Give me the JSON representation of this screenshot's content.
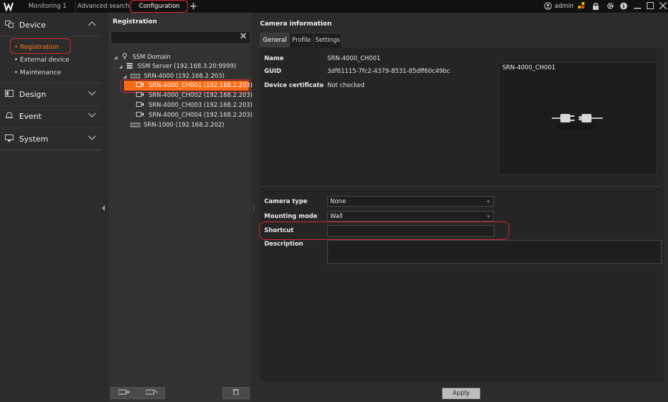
{
  "titlebar": {
    "tabs": [
      "Monitoring 1",
      "Advanced search",
      "Configuration"
    ],
    "user": "admin"
  },
  "nav": {
    "sections": [
      {
        "label": "Device",
        "items": [
          "Registration",
          "External device",
          "Maintenance"
        ]
      },
      {
        "label": "Design"
      },
      {
        "label": "Event"
      },
      {
        "label": "System"
      }
    ]
  },
  "registration": {
    "title": "Registration",
    "tree": [
      "SSM Domain",
      "SSM Server (192.168.3.20:9999)",
      "SRN-4000 (192.168.2.203)",
      "SRN-4000_CH001 (192.168.2.203)",
      "SRN-4000_CH002 (192.168.2.203)",
      "SRN-4000_CH003 (192.168.2.203)",
      "SRN-4000_CH004 (192.168.2.203)",
      "SRN-1000 (192.168.2.202)"
    ]
  },
  "camera": {
    "title": "Camera information",
    "tabs": [
      "General",
      "Profile",
      "Settings"
    ],
    "name_label": "Name",
    "name_value": "SRN-4000_CH001",
    "guid_label": "GUID",
    "guid_value": "3df61115-7fc2-4379-8531-85dff60c49bc",
    "cert_label": "Device certificate",
    "cert_value": "Not checked",
    "preview_title": "SRN-4000_CH001",
    "camera_type_label": "Camera type",
    "camera_type_value": "None",
    "mounting_label": "Mounting mode",
    "mounting_value": "Wall",
    "shortcut_label": "Shortcut",
    "shortcut_value": "",
    "description_label": "Description",
    "description_value": "",
    "apply_label": "Apply"
  },
  "colors": {
    "accent": "#ff6a13",
    "highlight": "#e0252b"
  }
}
